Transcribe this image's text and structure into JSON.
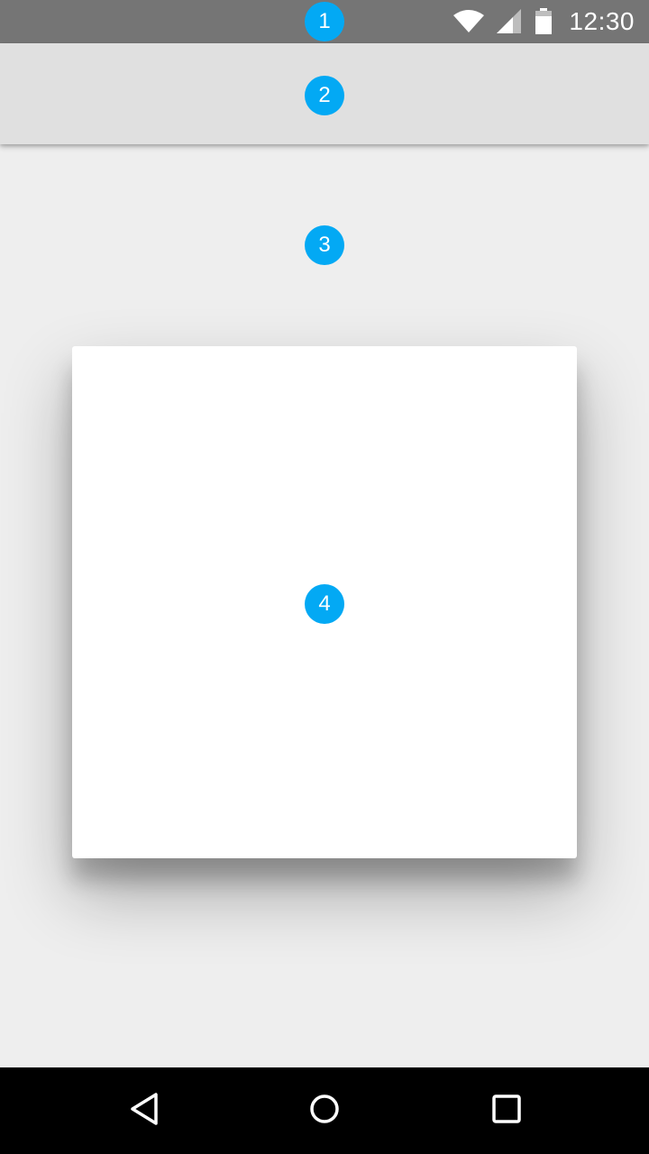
{
  "status_bar": {
    "time": "12:30",
    "icons": [
      "wifi-icon",
      "cell-signal-icon",
      "battery-icon"
    ],
    "background_color": "#757575"
  },
  "app_bar": {
    "background_color": "#e0e0e0"
  },
  "content": {
    "background_color": "#eeeeee"
  },
  "card": {
    "background_color": "#ffffff"
  },
  "badges": [
    {
      "label": "1"
    },
    {
      "label": "2"
    },
    {
      "label": "3"
    },
    {
      "label": "4"
    }
  ],
  "badge_color": "#03a9f4",
  "nav_bar": {
    "buttons": [
      "back-icon",
      "home-icon",
      "recents-icon"
    ],
    "background_color": "#000000"
  }
}
